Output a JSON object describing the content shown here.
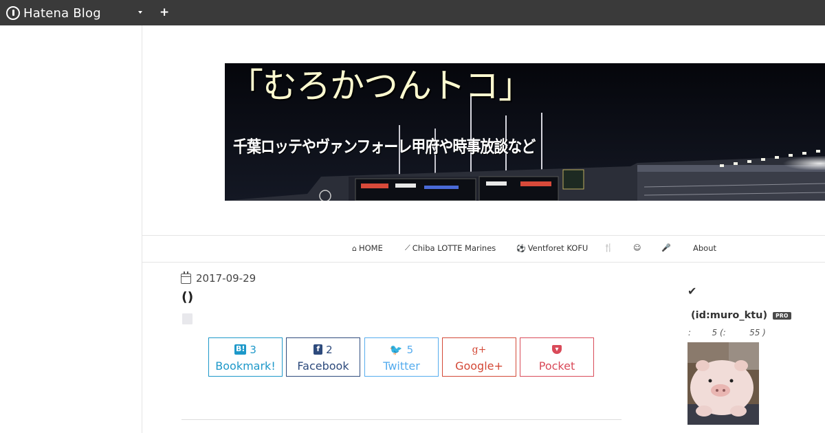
{
  "topbar": {
    "brand": "Hatena Blog",
    "add_label": "+"
  },
  "banner": {
    "title": "「むろかつんトコ」",
    "subtitle": "千葉ロッテやヴァンフォーレ甲府や時事放談など"
  },
  "nav": {
    "items": [
      {
        "icon": "home-icon",
        "glyph": "⌂",
        "label": "HOME"
      },
      {
        "icon": "chart-line-icon",
        "glyph": "⟋",
        "label": "Chiba LOTTE Marines"
      },
      {
        "icon": "soccer-ball-icon",
        "glyph": "⚽",
        "label": "Ventforet KOFU"
      },
      {
        "icon": "cutlery-icon",
        "glyph": "🍴",
        "label": ""
      },
      {
        "icon": "smile-icon",
        "glyph": "☺",
        "label": ""
      },
      {
        "icon": "microphone-icon",
        "glyph": "🎤",
        "label": ""
      },
      {
        "icon": "",
        "glyph": "",
        "label": "About"
      }
    ]
  },
  "article": {
    "date": "2017-09-29",
    "title": "()"
  },
  "shares": [
    {
      "name": "bookmark",
      "icon_text": "B!",
      "count": "3",
      "label": "Bookmark!",
      "color": "#1d98c9"
    },
    {
      "name": "facebook",
      "icon_text": "f",
      "count": "2",
      "label": "Facebook",
      "color": "#2d4a7c"
    },
    {
      "name": "twitter",
      "icon_text": "🐦",
      "count": "5",
      "label": "Twitter",
      "color": "#55acee"
    },
    {
      "name": "googleplus",
      "icon_text": "g+",
      "count": "",
      "label": "Google+",
      "color": "#d34836"
    },
    {
      "name": "pocket",
      "icon_text": "▾",
      "count": "",
      "label": "Pocket",
      "color": "#d94a59"
    }
  ],
  "sidebar": {
    "check_icon": "check-icon",
    "profile_id": "(id:muro_ktu)",
    "pro_badge": "PRO",
    "stats": ":        5 (:         55 )"
  },
  "colors": {
    "topbar_bg": "#3a3a3a",
    "border": "#e4e4e4"
  }
}
